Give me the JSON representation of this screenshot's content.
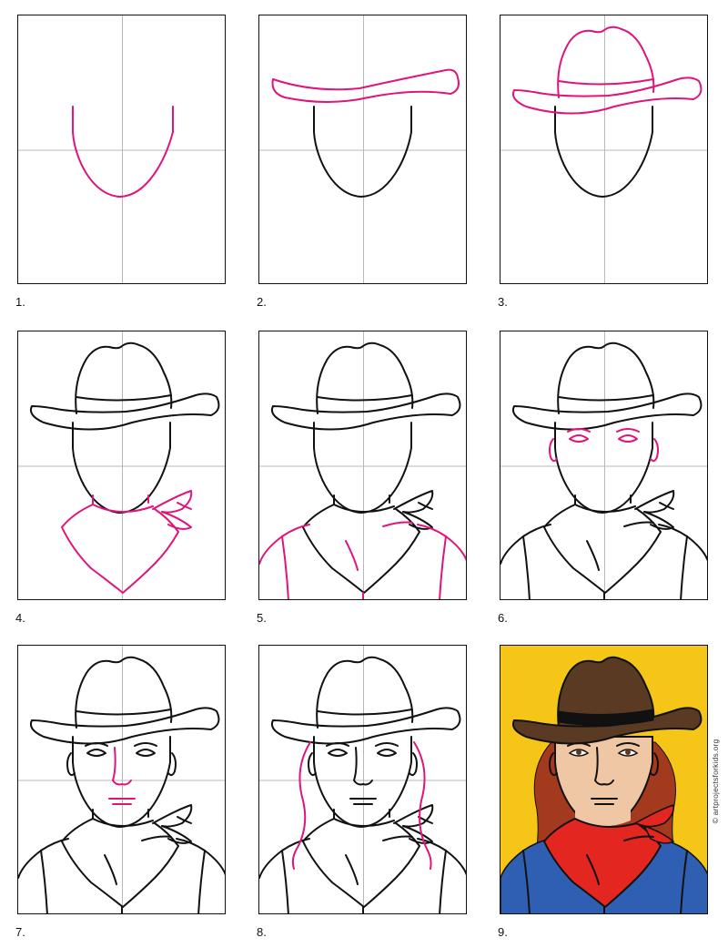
{
  "steps": [
    {
      "label": "1."
    },
    {
      "label": "2."
    },
    {
      "label": "3."
    },
    {
      "label": "4."
    },
    {
      "label": "5."
    },
    {
      "label": "6."
    },
    {
      "label": "7."
    },
    {
      "label": "8."
    },
    {
      "label": "9."
    }
  ],
  "credit": "© artprojectsforkids.org",
  "colors": {
    "new_line": "#e0147a",
    "ink": "#111111",
    "guide": "#b8b8b8",
    "bg_yellow": "#f5c518",
    "hat_brown": "#5a3a22",
    "hat_band": "#111111",
    "skin": "#f0c7a4",
    "hair": "#a33a1e",
    "bandana_red": "#e3261f",
    "shirt_blue": "#2f5fb3"
  }
}
